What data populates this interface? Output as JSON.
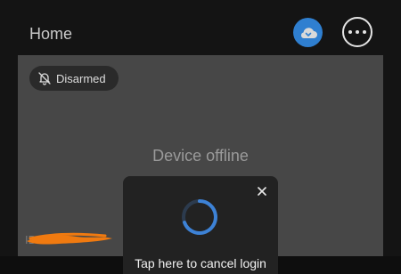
{
  "header": {
    "title": "Home",
    "cloud_icon": "cloud-storage-icon",
    "more_icon": "more-options-icon"
  },
  "camera": {
    "status_label": "Disarmed",
    "status_icon": "bell-off-icon",
    "offline_message": "Device offline",
    "id_label": "ID:"
  },
  "login_overlay": {
    "close_icon": "close-icon",
    "spinner_icon": "loading-spinner-icon",
    "cancel_text": "Tap here to cancel login"
  },
  "colors": {
    "background": "#141414",
    "card": "#474747",
    "accent": "#2f7fd0",
    "redaction": "#f07a10"
  }
}
